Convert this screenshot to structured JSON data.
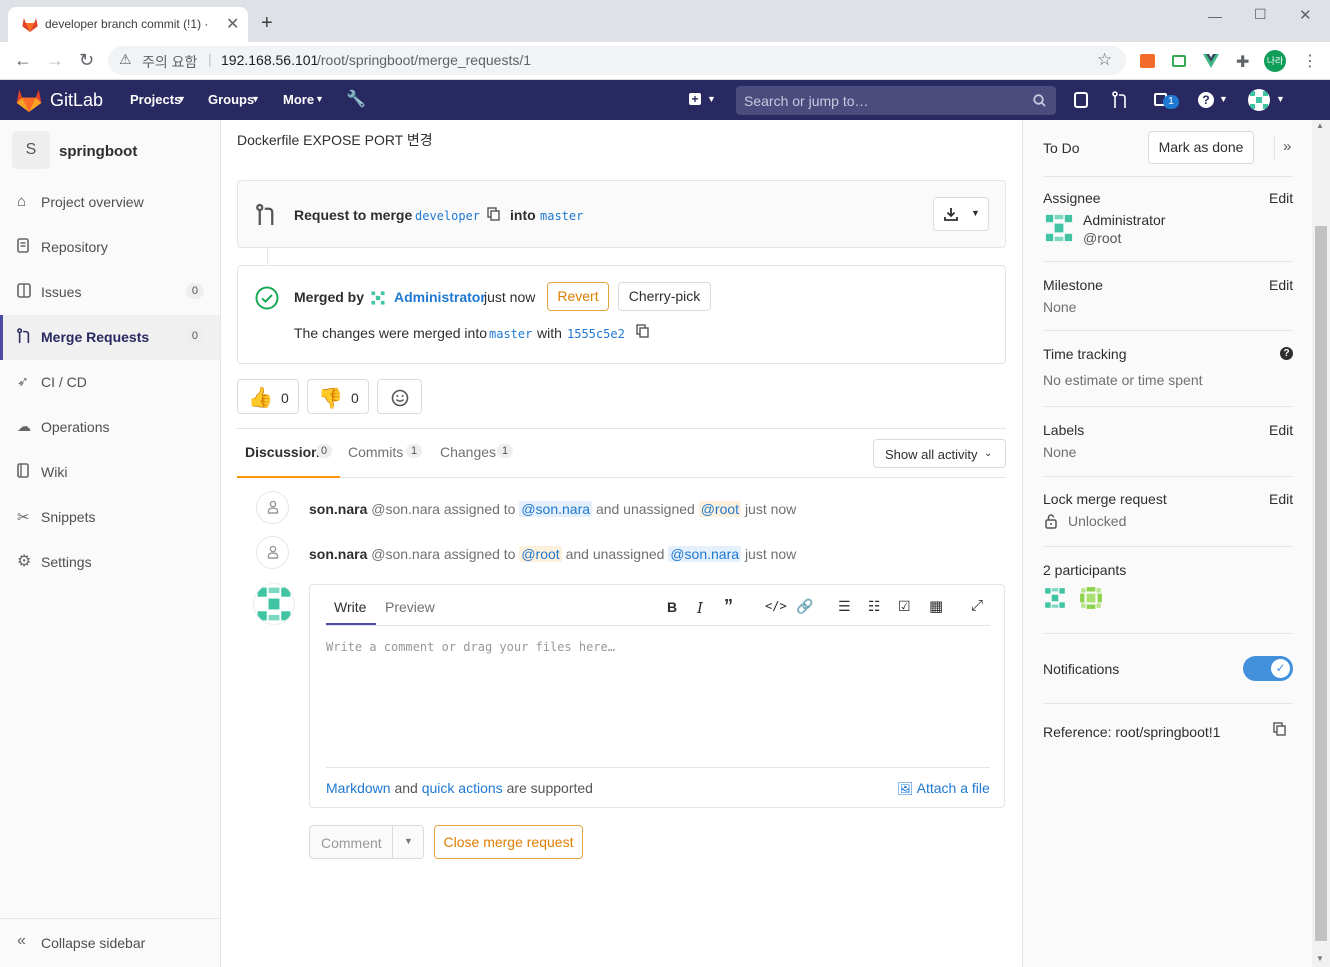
{
  "browser": {
    "tab_title": "developer branch commit (!1) ·",
    "new_tab": "+",
    "address_warning": "주의 요함",
    "url_host": "192.168.56.101",
    "url_path": "/root/springboot/merge_requests/1",
    "profile_label": "나라"
  },
  "header": {
    "brand": "GitLab",
    "nav": [
      "Projects",
      "Groups",
      "More"
    ],
    "search_placeholder": "Search or jump to…",
    "todo_count": "1"
  },
  "sidebar": {
    "project_initial": "S",
    "project_name": "springboot",
    "items": [
      {
        "label": "Project overview",
        "icon": "home-icon"
      },
      {
        "label": "Repository",
        "icon": "doc-icon"
      },
      {
        "label": "Issues",
        "icon": "issues-icon",
        "badge": "0"
      },
      {
        "label": "Merge Requests",
        "icon": "merge-request-icon",
        "badge": "0",
        "active": true
      },
      {
        "label": "CI / CD",
        "icon": "rocket-icon"
      },
      {
        "label": "Operations",
        "icon": "cloud-gear-icon"
      },
      {
        "label": "Wiki",
        "icon": "book-icon"
      },
      {
        "label": "Snippets",
        "icon": "scissors-icon"
      },
      {
        "label": "Settings",
        "icon": "gear-icon"
      }
    ],
    "collapse": "Collapse sidebar"
  },
  "mr": {
    "description": "Dockerfile EXPOSE PORT 변경",
    "request_to_merge": "Request to merge",
    "source_branch": "developer",
    "into": "into",
    "target_branch": "master",
    "merged_by": "Merged by",
    "merged_user": "Administrator",
    "merged_time": "just now",
    "revert": "Revert",
    "cherry_pick": "Cherry-pick",
    "changes_merged_into": "The changes were merged into",
    "with": "with",
    "commit_sha": "1555c5e2",
    "thumbs_up": "0",
    "thumbs_down": "0"
  },
  "tabs": [
    {
      "label": "Discussion",
      "count": "0"
    },
    {
      "label": "Commits",
      "count": "1"
    },
    {
      "label": "Changes",
      "count": "1"
    }
  ],
  "activity_filter": "Show all activity",
  "notes": [
    {
      "author": "son.nara",
      "handle": "@son.nara",
      "action": "assigned to",
      "m1": "@son.nara",
      "mid": "and unassigned",
      "m2": "@root",
      "time": "just now"
    },
    {
      "author": "son.nara",
      "handle": "@son.nara",
      "action": "assigned to",
      "m1": "@root",
      "mid": "and unassigned",
      "m2": "@son.nara",
      "time": "just now"
    }
  ],
  "comment_form": {
    "write": "Write",
    "preview": "Preview",
    "placeholder": "Write a comment or drag your files here…",
    "markdown": "Markdown",
    "and": "and",
    "quick_actions": "quick actions",
    "supported": "are supported",
    "attach": "Attach a file",
    "comment_btn": "Comment",
    "close_btn": "Close merge request"
  },
  "right_sidebar": {
    "todo": "To Do",
    "mark_done": "Mark as done",
    "assignee_title": "Assignee",
    "edit": "Edit",
    "assignee_name": "Administrator",
    "assignee_handle": "@root",
    "milestone_title": "Milestone",
    "milestone_value": "None",
    "time_title": "Time tracking",
    "time_value": "No estimate or time spent",
    "labels_title": "Labels",
    "labels_value": "None",
    "lock_title": "Lock merge request",
    "lock_value": "Unlocked",
    "participants": "2 participants",
    "notifications": "Notifications",
    "notifications_on": true,
    "reference": "Reference: root/springboot!1"
  },
  "colors": {
    "header": "#292961",
    "link": "#1f78d1",
    "success": "#1aaa55",
    "warning_border": "#e4a33f",
    "toggle": "#428fdc"
  }
}
